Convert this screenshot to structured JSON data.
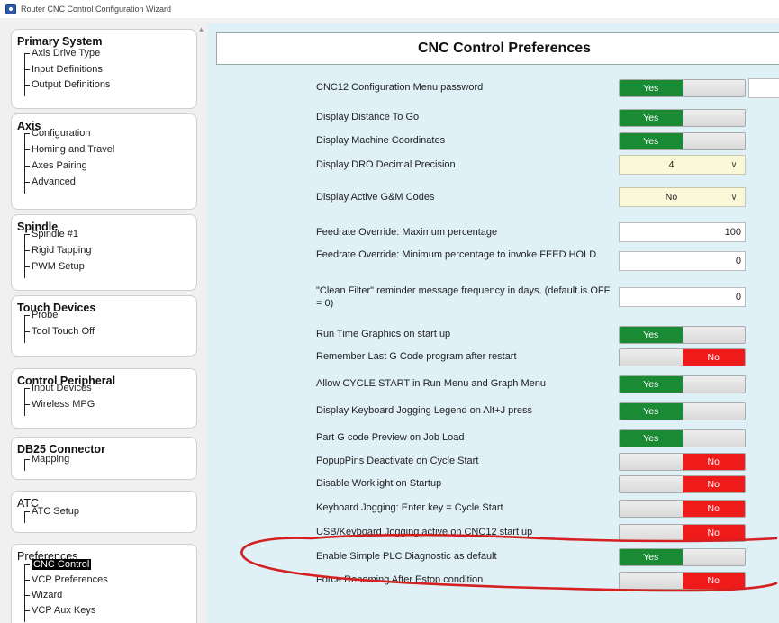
{
  "window": {
    "title": "Router CNC Control Configuration Wizard"
  },
  "sidebar": {
    "groups": [
      {
        "title": "Primary System",
        "items": [
          "Axis Drive Type",
          "Input Definitions",
          "Output Definitions"
        ]
      },
      {
        "title": "Axis",
        "items": [
          "Configuration",
          "Homing and Travel",
          "Axes Pairing",
          "Advanced"
        ]
      },
      {
        "title": "Spindle",
        "items": [
          "Spindle #1",
          "Rigid Tapping",
          "PWM Setup"
        ]
      },
      {
        "title": "Touch Devices",
        "items": [
          "Probe",
          "Tool Touch Off"
        ]
      },
      {
        "title": "Control Peripheral",
        "items": [
          "Input Devices",
          "Wireless MPG"
        ]
      },
      {
        "title": "DB25 Connector",
        "items": [
          "Mapping"
        ]
      },
      {
        "title": "ATC",
        "items": [
          "ATC Setup"
        ]
      },
      {
        "title": "Preferences",
        "items": [
          "CNC Control",
          "VCP Preferences",
          "Wizard",
          "VCP Aux Keys"
        ],
        "selected": "CNC Control"
      }
    ]
  },
  "main": {
    "title": "CNC Control Preferences",
    "toggle_labels": {
      "yes": "Yes",
      "no": "No"
    },
    "settings": [
      {
        "label": "CNC12 Configuration Menu password",
        "type": "toggle",
        "value": "Yes"
      },
      {
        "label": "Display Distance To Go",
        "type": "toggle",
        "value": "Yes"
      },
      {
        "label": "Display Machine Coordinates",
        "type": "toggle",
        "value": "Yes"
      },
      {
        "label": "Display DRO Decimal Precision",
        "type": "select",
        "value": "4"
      },
      {
        "label": "Display Active G&M Codes",
        "type": "select",
        "value": "No"
      },
      {
        "label": "Feedrate Override: Maximum percentage",
        "type": "number",
        "value": "100"
      },
      {
        "label": "Feedrate Override: Minimum percentage to invoke FEED HOLD",
        "type": "number",
        "value": "0"
      },
      {
        "label": "\"Clean Filter\" reminder message frequency in days. (default is OFF = 0)",
        "type": "number",
        "value": "0"
      },
      {
        "label": "Run Time Graphics on start up",
        "type": "toggle",
        "value": "Yes"
      },
      {
        "label": "Remember Last G Code program after restart",
        "type": "toggle",
        "value": "No"
      },
      {
        "label": "Allow CYCLE START in Run Menu and Graph Menu",
        "type": "toggle",
        "value": "Yes"
      },
      {
        "label": "Display Keyboard Jogging Legend on Alt+J press",
        "type": "toggle",
        "value": "Yes"
      },
      {
        "label": "Part G code Preview on Job Load",
        "type": "toggle",
        "value": "Yes"
      },
      {
        "label": "PopupPins Deactivate on Cycle Start",
        "type": "toggle",
        "value": "No"
      },
      {
        "label": "Disable Worklight on Startup",
        "type": "toggle",
        "value": "No"
      },
      {
        "label": "Keyboard Jogging: Enter key = Cycle Start",
        "type": "toggle",
        "value": "No"
      },
      {
        "label": "USB/Keyboard Jogging active on CNC12 start up",
        "type": "toggle",
        "value": "No"
      },
      {
        "label": "Enable Simple PLC Diagnostic as default",
        "type": "toggle",
        "value": "Yes"
      },
      {
        "label": "Force Rehoming After Estop condition",
        "type": "toggle",
        "value": "No"
      }
    ]
  },
  "colors": {
    "yes": "#1a8a35",
    "no": "#ef1a1a",
    "panel": "#dff0f7",
    "select_bg": "#fbf7d9",
    "annotation": "#d42020"
  },
  "icons": [
    "app-icon",
    "chevron-down-icon",
    "scroll-up-icon"
  ]
}
